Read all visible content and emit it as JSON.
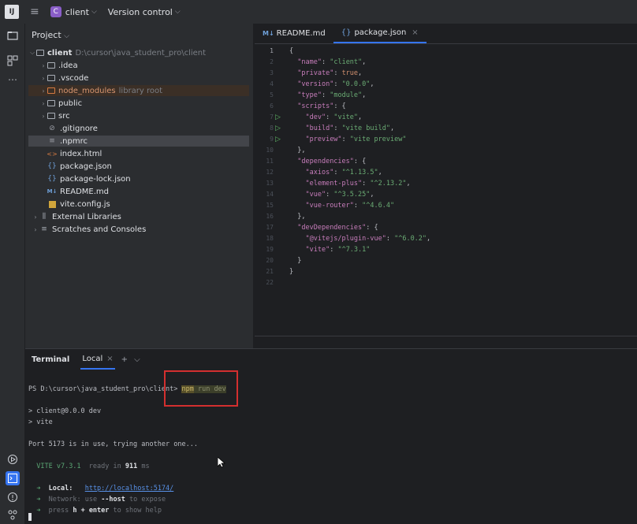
{
  "titlebar": {
    "logo": "IJ",
    "project_badge": "C",
    "project_name": "client",
    "version_control": "Version control"
  },
  "leftbar": {
    "icons": [
      "folder-icon",
      "structure-icon",
      "more-icon",
      "run-icon",
      "terminal-icon",
      "problems-icon",
      "git-icon"
    ]
  },
  "project_panel": {
    "title": "Project",
    "root_name": "client",
    "root_path": "D:\\cursor\\java_student_pro\\client",
    "items": [
      {
        "label": ".idea"
      },
      {
        "label": ".vscode"
      },
      {
        "label": "node_modules",
        "note": "library root"
      },
      {
        "label": "public"
      },
      {
        "label": "src"
      },
      {
        "label": ".gitignore"
      },
      {
        "label": ".npmrc"
      },
      {
        "label": "index.html"
      },
      {
        "label": "package.json"
      },
      {
        "label": "package-lock.json"
      },
      {
        "label": "README.md"
      },
      {
        "label": "vite.config.js"
      },
      {
        "label": "External Libraries"
      },
      {
        "label": "Scratches and Consoles"
      }
    ]
  },
  "editor": {
    "tabs": [
      {
        "badge": "M↓",
        "label": "README.md"
      },
      {
        "badge": "{}",
        "label": "package.json"
      }
    ],
    "line_numbers": [
      "1",
      "2",
      "3",
      "4",
      "5",
      "6",
      "7",
      "8",
      "9",
      "10",
      "11",
      "12",
      "13",
      "14",
      "15",
      "16",
      "17",
      "18",
      "19",
      "20",
      "21",
      "22"
    ],
    "code": {
      "l1": "{",
      "name_k": "\"name\"",
      "name_v": "\"client\"",
      "private_k": "\"private\"",
      "private_v": "true",
      "version_k": "\"version\"",
      "version_v": "\"0.0.0\"",
      "type_k": "\"type\"",
      "type_v": "\"module\"",
      "scripts_k": "\"scripts\"",
      "dev_k": "\"dev\"",
      "dev_v": "\"vite\"",
      "build_k": "\"build\"",
      "build_v": "\"vite build\"",
      "preview_k": "\"preview\"",
      "preview_v": "\"vite preview\"",
      "deps_k": "\"dependencies\"",
      "axios_k": "\"axios\"",
      "axios_v": "\"^1.13.5\"",
      "ep_k": "\"element-plus\"",
      "ep_v": "\"^2.13.2\"",
      "vue_k": "\"vue\"",
      "vue_v": "\"^3.5.25\"",
      "vr_k": "\"vue-router\"",
      "vr_v": "\"^4.6.4\"",
      "devdeps_k": "\"devDependencies\"",
      "pv_k": "\"@vitejs/plugin-vue\"",
      "pv_v": "\"^6.0.2\"",
      "vite_k": "\"vite\"",
      "vite_v": "\"^7.3.1\""
    }
  },
  "terminal": {
    "title": "Terminal",
    "tab": "Local",
    "prompt": "PS D:\\cursor\\java_student_pro\\client>",
    "cmd_npm": "npm",
    "cmd_rest": "run dev",
    "out1": "> client@0.0.0 dev",
    "out2": "> vite",
    "out3": "Port 5173 is in use, trying another one...",
    "vite_name": "VITE v7.3.1",
    "ready": "ready in",
    "ready_ms": "911",
    "ms": "ms",
    "arrow": "➜",
    "local_label": "Local:",
    "local_url": "http://localhost:5174/",
    "network_label": "Network:",
    "network_use": "use",
    "network_flag": "--host",
    "network_rest": "to expose",
    "press": "press",
    "press_key": "h + enter",
    "press_rest": "to show help"
  }
}
